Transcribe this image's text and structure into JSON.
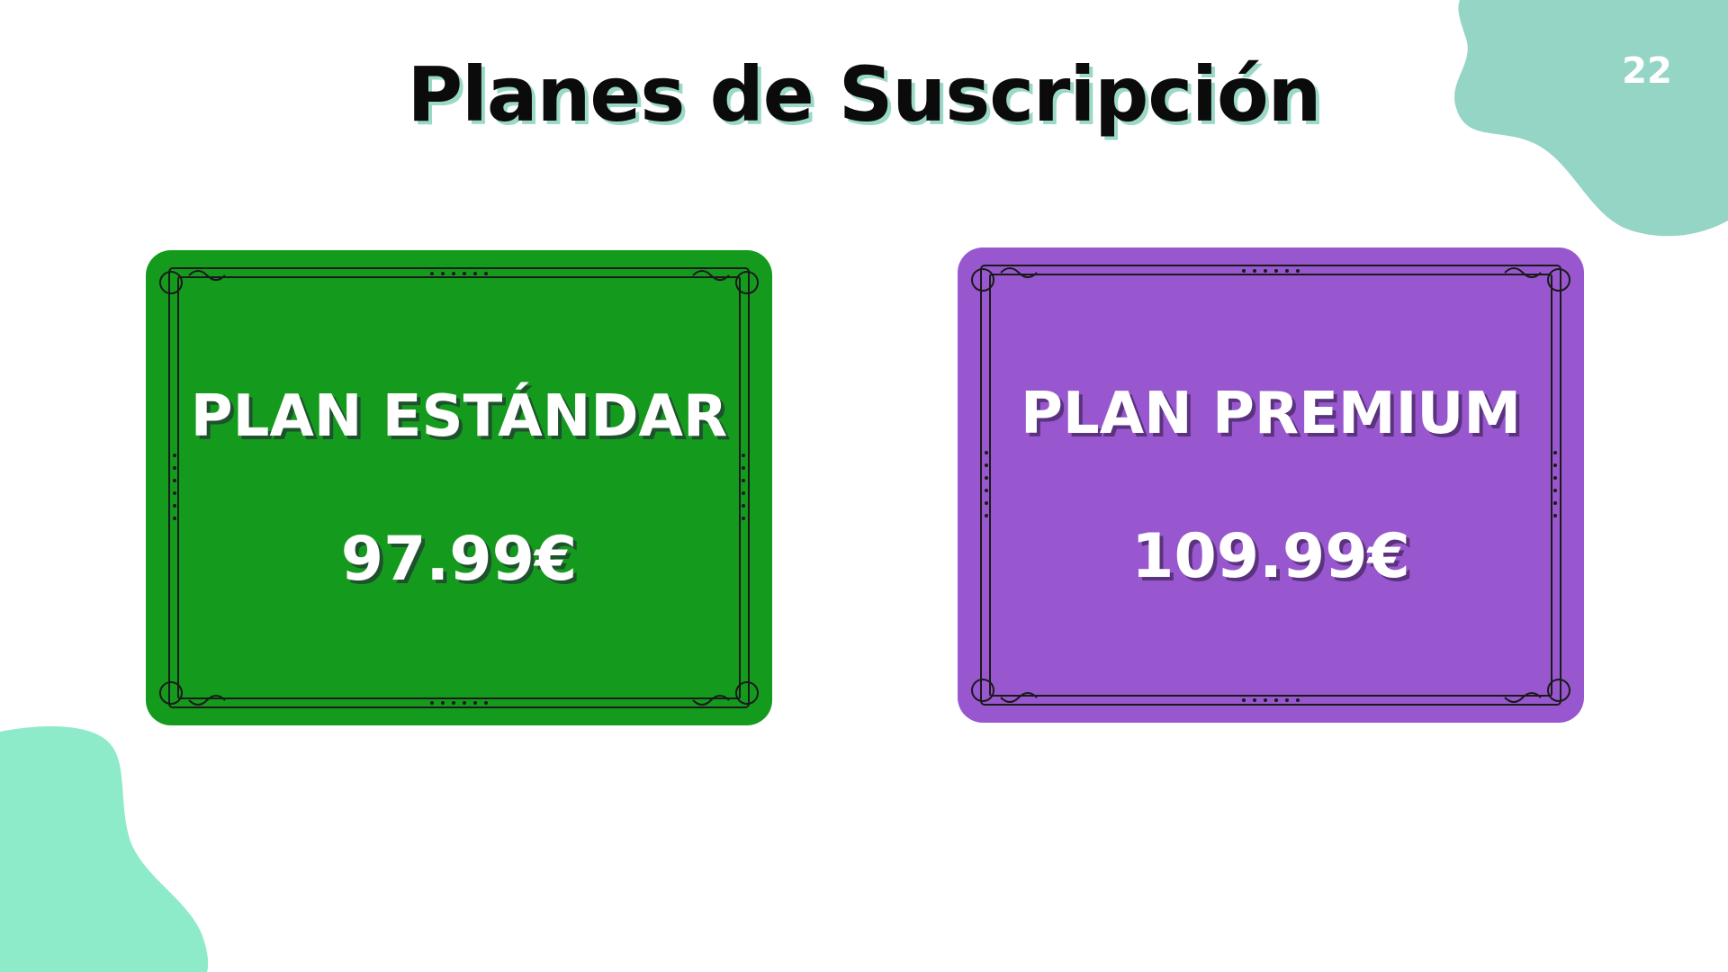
{
  "slide": {
    "title": "Planes de Suscripción",
    "page_number": "22"
  },
  "plans": [
    {
      "name": "PLAN ESTÁNDAR",
      "price": "97.99€",
      "color": "#149b1d"
    },
    {
      "name": "PLAN PREMIUM",
      "price": "109.99€",
      "color": "#9857ce"
    }
  ],
  "colors": {
    "blob_top_right": "#95d5c6",
    "blob_bottom_left": "#8eebc9",
    "title_shadow": "#9ad8c7"
  }
}
